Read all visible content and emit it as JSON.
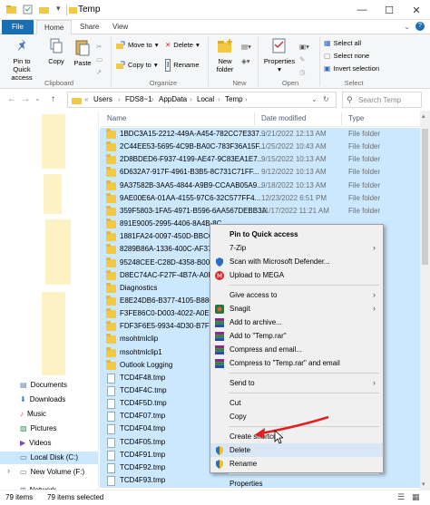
{
  "window": {
    "title": "Temp",
    "minimize": "—",
    "maximize": "☐",
    "close": "✕"
  },
  "tabs": [
    "File",
    "Home",
    "Share",
    "View"
  ],
  "ribbon": {
    "clipboard": {
      "pin": "Pin to Quick\naccess",
      "copy": "Copy",
      "paste": "Paste",
      "label": "Clipboard"
    },
    "organize": {
      "move_to": "Move to",
      "copy_to": "Copy to",
      "delete": "Delete",
      "rename": "Rename",
      "label": "Organize"
    },
    "new": {
      "new_folder": "New\nfolder",
      "label": "New"
    },
    "open": {
      "properties": "Properties",
      "label": "Open"
    },
    "select": {
      "select_all": "Select all",
      "select_none": "Select none",
      "invert": "Invert selection",
      "label": "Select"
    }
  },
  "address": {
    "crumbs": [
      "Users",
      "FDS8~1",
      "AppData",
      "Local",
      "Temp"
    ],
    "search_placeholder": "Search Temp"
  },
  "nav": {
    "items": [
      {
        "label": "Documents",
        "icon": "documents-icon"
      },
      {
        "label": "Downloads",
        "icon": "downloads-icon"
      },
      {
        "label": "Music",
        "icon": "music-icon"
      },
      {
        "label": "Pictures",
        "icon": "pictures-icon"
      },
      {
        "label": "Videos",
        "icon": "videos-icon"
      },
      {
        "label": "Local Disk (C:)",
        "icon": "drive-icon"
      },
      {
        "label": "New Volume (F:)",
        "icon": "drive-icon"
      },
      {
        "label": "Network",
        "icon": "network-icon"
      }
    ]
  },
  "columns": {
    "name": "Name",
    "date": "Date modified",
    "type": "Type"
  },
  "files": [
    {
      "name": "1BDC3A15-2212-449A-A454-782CC7E337...",
      "date": "9/21/2022 12:13 AM",
      "type": "File folder",
      "kind": "folder"
    },
    {
      "name": "2C44EE53-5695-4C9B-BA0C-783F36A15F...",
      "date": "1/25/2022 10:43 AM",
      "type": "File folder",
      "kind": "folder"
    },
    {
      "name": "2D8BDED6-F937-4199-AE47-9C83EA1E7...",
      "date": "9/15/2022 10:13 AM",
      "type": "File folder",
      "kind": "folder"
    },
    {
      "name": "6D632A7-917F-4961-B3B5-8C731C71FF...",
      "date": "9/12/2022 10:13 AM",
      "type": "File folder",
      "kind": "folder"
    },
    {
      "name": "9A37582B-3AA5-4844-A9B9-CCAAB05A9...",
      "date": "9/18/2022 10:13 AM",
      "type": "File folder",
      "kind": "folder"
    },
    {
      "name": "9AE00E6A-01AA-4155-97C6-32C577FF4...",
      "date": "12/23/2022 6:51 PM",
      "type": "File folder",
      "kind": "folder"
    },
    {
      "name": "359F5803-1FA5-4971-B596-6AA567DEBB3A",
      "date": "11/17/2022 11:21 AM",
      "type": "File folder",
      "kind": "folder"
    },
    {
      "name": "891E9005-2995-4406-8A4B-8C...",
      "date": "",
      "type": "",
      "kind": "folder"
    },
    {
      "name": "1881FA24-0097-450D-BBC6-F...",
      "date": "",
      "type": "",
      "kind": "folder"
    },
    {
      "name": "8289B86A-1336-400C-AF37-...",
      "date": "",
      "type": "",
      "kind": "folder"
    },
    {
      "name": "95248CEE-C28D-4358-B00...",
      "date": "",
      "type": "",
      "kind": "folder"
    },
    {
      "name": "D8EC74AC-F27F-4B7A-A0FF...",
      "date": "",
      "type": "",
      "kind": "folder"
    },
    {
      "name": "Diagnostics",
      "date": "",
      "type": "",
      "kind": "folder"
    },
    {
      "name": "E8E24DB6-B377-4105-B886-...",
      "date": "",
      "type": "",
      "kind": "folder"
    },
    {
      "name": "F3FE86C0-D003-4022-A0E0-...",
      "date": "",
      "type": "",
      "kind": "folder"
    },
    {
      "name": "FDF3F6E5-9934-4D30-B7FF-...",
      "date": "",
      "type": "",
      "kind": "folder"
    },
    {
      "name": "msohtmlclip",
      "date": "",
      "type": "",
      "kind": "folder"
    },
    {
      "name": "msohtmlclip1",
      "date": "",
      "type": "",
      "kind": "folder"
    },
    {
      "name": "Outlook Logging",
      "date": "",
      "type": "",
      "kind": "folder"
    },
    {
      "name": "TCD4F48.tmp",
      "date": "",
      "type": "",
      "kind": "file"
    },
    {
      "name": "TCD4F4C.tmp",
      "date": "",
      "type": "",
      "kind": "file"
    },
    {
      "name": "TCD4F5D.tmp",
      "date": "",
      "type": "",
      "kind": "file"
    },
    {
      "name": "TCD4F07.tmp",
      "date": "",
      "type": "",
      "kind": "file"
    },
    {
      "name": "TCD4F04.tmp",
      "date": "",
      "type": "",
      "kind": "file"
    },
    {
      "name": "TCD4F05.tmp",
      "date": "",
      "type": "",
      "kind": "file"
    },
    {
      "name": "TCD4F91.tmp",
      "date": "",
      "type": "",
      "kind": "file"
    },
    {
      "name": "TCD4F92.tmp",
      "date": "",
      "type": "",
      "kind": "file"
    },
    {
      "name": "TCD4F93.tmp",
      "date": "",
      "type": "",
      "kind": "file"
    }
  ],
  "context_menu": [
    {
      "label": "Pin to Quick access",
      "bold": true,
      "icon": ""
    },
    {
      "label": "7-Zip",
      "submenu": true,
      "icon": ""
    },
    {
      "label": "Scan with Microsoft Defender...",
      "icon": "defender-icon"
    },
    {
      "label": "Upload to MEGA",
      "icon": "mega-icon"
    },
    {
      "sep": true
    },
    {
      "label": "Give access to",
      "submenu": true,
      "icon": ""
    },
    {
      "label": "Snagit",
      "submenu": true,
      "icon": "snagit-icon"
    },
    {
      "label": "Add to archive...",
      "icon": "winrar-icon"
    },
    {
      "label": "Add to \"Temp.rar\"",
      "icon": "winrar-icon"
    },
    {
      "label": "Compress and email...",
      "icon": "winrar-icon"
    },
    {
      "label": "Compress to \"Temp.rar\" and email",
      "icon": "winrar-icon"
    },
    {
      "sep": true
    },
    {
      "label": "Send to",
      "submenu": true,
      "icon": ""
    },
    {
      "sep": true
    },
    {
      "label": "Cut",
      "icon": ""
    },
    {
      "label": "Copy",
      "icon": ""
    },
    {
      "sep": true
    },
    {
      "label": "Create shortcut",
      "icon": ""
    },
    {
      "label": "Delete",
      "icon": "shield-icon",
      "highlight": true
    },
    {
      "label": "Rename",
      "icon": "shield-icon"
    },
    {
      "sep": true
    },
    {
      "label": "Properties",
      "icon": ""
    }
  ],
  "status": {
    "items": "79 items",
    "selected": "79 items selected"
  },
  "colors": {
    "selection": "#cce8ff",
    "accent": "#1a6fb3",
    "arrow": "#e02020"
  }
}
